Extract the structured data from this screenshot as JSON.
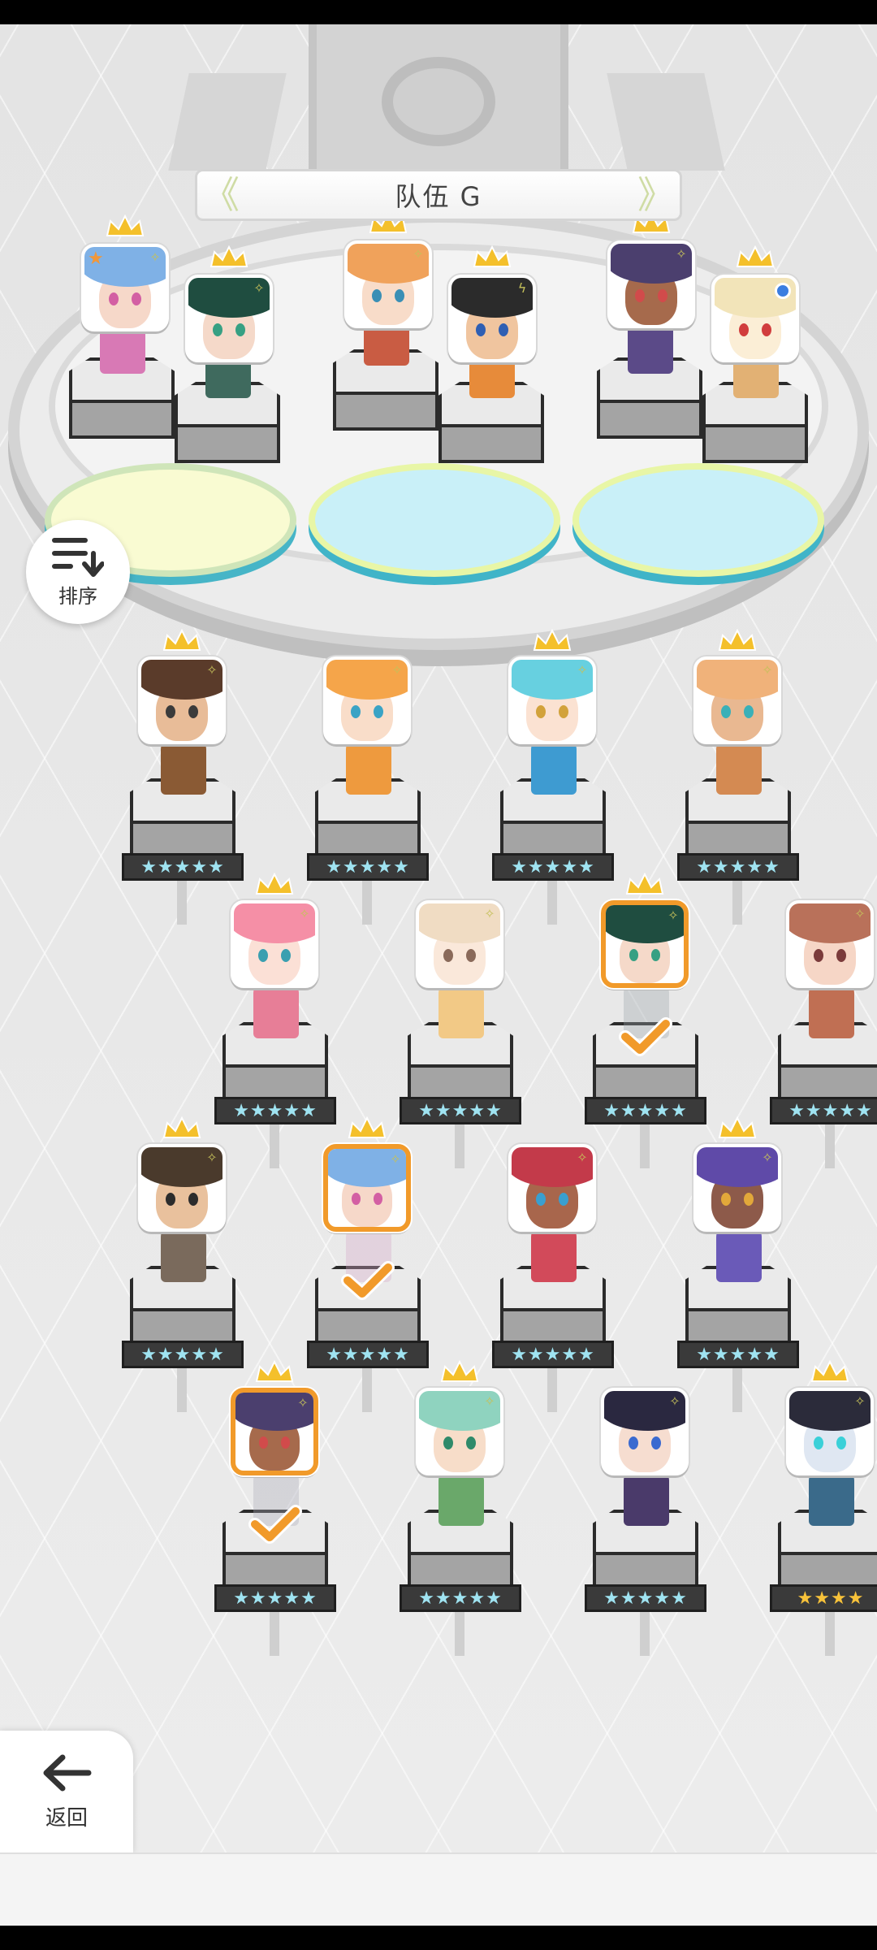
{
  "team": {
    "title": "队伍 G",
    "prev_arrow": "《",
    "next_arrow": "》"
  },
  "sort_button": {
    "label": "排序",
    "icon": "sort-icon"
  },
  "back_button": {
    "label": "返回",
    "icon": "arrow-left-icon"
  },
  "star_glyph": "★",
  "colors": {
    "selected_border": "#f19a2a",
    "star_blue": "#9fe3f1",
    "star_gold": "#f7c23a",
    "crown": "#f4c02b",
    "check": "#f19a2a"
  },
  "formation": [
    {
      "slot": 1,
      "hair": "#7fb1e6",
      "skin": "#f6d8c9",
      "eye": "#d35fa3",
      "crown": true,
      "badge": "star",
      "sprite": "#d879b5"
    },
    {
      "slot": 2,
      "hair": "#1f4d40",
      "skin": "#f5d9c9",
      "eye": "#37a083",
      "crown": true,
      "badge": "sparkle",
      "sprite": "#3f6a5e"
    },
    {
      "slot": 3,
      "hair": "#f0a25b",
      "skin": "#f8dcc9",
      "eye": "#3a8fb5",
      "crown": true,
      "badge": "sparkle",
      "sprite": "#c95c43"
    },
    {
      "slot": 4,
      "hair": "#2b2b2b",
      "skin": "#f0c59f",
      "eye": "#2f5fb3",
      "crown": true,
      "badge": "lightning",
      "sprite": "#e78b3a"
    },
    {
      "slot": 5,
      "hair": "#4b3f6e",
      "skin": "#a66a4c",
      "eye": "#d14b4b",
      "crown": true,
      "badge": "sparkle",
      "sprite": "#5b4a88"
    },
    {
      "slot": 6,
      "hair": "#f2e4b9",
      "skin": "#fbeed6",
      "eye": "#d13d3d",
      "crown": true,
      "badge": "blue-dot",
      "sprite": "#e2b174"
    }
  ],
  "roster": [
    {
      "hair": "#5a3b2a",
      "skin": "#e8bc98",
      "eye": "#3b3b3b",
      "crown": true,
      "selected": false,
      "stars": 5,
      "star_color": "blue",
      "sprite": "#8a5a34"
    },
    {
      "hair": "#f5a54a",
      "skin": "#f9ddc9",
      "eye": "#3aa3c5",
      "crown": false,
      "selected": false,
      "stars": 5,
      "star_color": "blue",
      "sprite": "#ee9a3e"
    },
    {
      "hair": "#67d0e0",
      "skin": "#fbe2d2",
      "eye": "#d2a23b",
      "crown": true,
      "selected": false,
      "stars": 5,
      "star_color": "blue",
      "sprite": "#3e9bd1"
    },
    {
      "hair": "#f0b27a",
      "skin": "#e9b891",
      "eye": "#3ab0b8",
      "crown": true,
      "selected": false,
      "stars": 5,
      "star_color": "blue",
      "sprite": "#d48a52"
    },
    {
      "hair": "#f58fa6",
      "skin": "#fbe0d6",
      "eye": "#3a9fb0",
      "crown": true,
      "selected": false,
      "stars": 5,
      "star_color": "blue",
      "sprite": "#e77e97"
    },
    {
      "hair": "#f0dcc3",
      "skin": "#fae8da",
      "eye": "#8a6a5a",
      "crown": false,
      "selected": false,
      "stars": 5,
      "star_color": "blue",
      "sprite": "#f2c986"
    },
    {
      "hair": "#1f4d40",
      "skin": "#f5d9c9",
      "eye": "#37a083",
      "crown": true,
      "selected": true,
      "stars": 5,
      "star_color": "blue",
      "sprite": "#9aa3a8"
    },
    {
      "hair": "#b9715a",
      "skin": "#f6d6c6",
      "eye": "#7b3b3b",
      "crown": false,
      "selected": false,
      "stars": 5,
      "star_color": "blue",
      "sprite": "#c06f53"
    },
    {
      "hair": "#4a3a2c",
      "skin": "#e9c19d",
      "eye": "#2c2c2c",
      "crown": true,
      "selected": false,
      "stars": 5,
      "star_color": "blue",
      "sprite": "#7a6a5c"
    },
    {
      "hair": "#7fb1e6",
      "skin": "#f6d8c9",
      "eye": "#d35fa3",
      "crown": true,
      "selected": true,
      "stars": 5,
      "star_color": "blue",
      "sprite": "#d8a8c8"
    },
    {
      "hair": "#c33a4a",
      "skin": "#a8664c",
      "eye": "#3a9fd0",
      "crown": false,
      "selected": false,
      "stars": 5,
      "star_color": "blue",
      "sprite": "#d24a5a"
    },
    {
      "hair": "#5f4aa8",
      "skin": "#8d5a4a",
      "eye": "#e2a83a",
      "crown": true,
      "selected": false,
      "stars": 5,
      "star_color": "blue",
      "sprite": "#6a5ab8"
    },
    {
      "hair": "#4b3f6e",
      "skin": "#a66a4c",
      "eye": "#d14b4b",
      "crown": true,
      "selected": true,
      "stars": 5,
      "star_color": "blue",
      "sprite": "#a8a8b8"
    },
    {
      "hair": "#8fd3bf",
      "skin": "#f7ddc9",
      "eye": "#2f8a6a",
      "crown": true,
      "selected": false,
      "stars": 5,
      "star_color": "blue",
      "sprite": "#6aa86a"
    },
    {
      "hair": "#2a2840",
      "skin": "#f6ddd0",
      "eye": "#3a6ad0",
      "crown": false,
      "selected": false,
      "stars": 5,
      "star_color": "blue",
      "sprite": "#4a3a6a"
    },
    {
      "hair": "#2b2b3a",
      "skin": "#dfe7f2",
      "eye": "#3ad0d8",
      "crown": true,
      "selected": false,
      "stars": 4,
      "star_color": "gold",
      "sprite": "#3a6a8a"
    }
  ]
}
